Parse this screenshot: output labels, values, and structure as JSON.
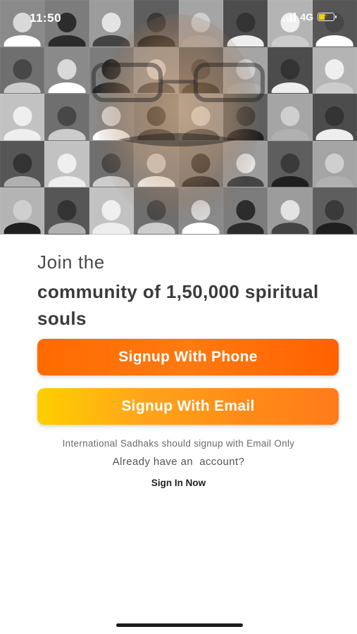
{
  "status_bar": {
    "time": "11:50",
    "network": "4G",
    "icons": [
      "signal-bars-icon",
      "battery-charging-icon"
    ],
    "battery_color": "#f5d000"
  },
  "hero": {
    "description_icon": "community-photo-mosaic",
    "columns": 8,
    "rows": 5
  },
  "content": {
    "join_text": "Join the",
    "headline": "community of 1,50,000 spiritual souls",
    "signup_phone_label": "Signup With Phone",
    "signup_email_label": "Signup With Email",
    "international_note": "International Sadhaks should signup with Email Only",
    "already_account": "Already have an  account?",
    "sign_in_label": "Sign In Now"
  },
  "colors": {
    "phone_button": "#ff6a00",
    "email_button_start": "#ffcf00",
    "email_button_end": "#ff7b1a",
    "headline_text": "#3b3b3b"
  }
}
